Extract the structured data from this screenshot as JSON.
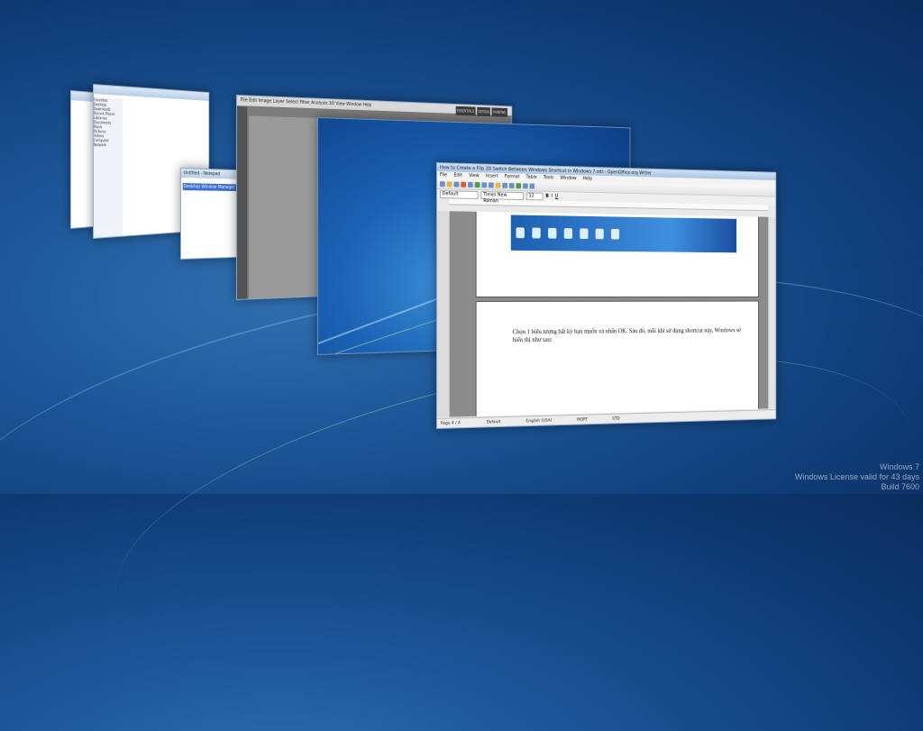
{
  "windows": {
    "explorer_small": {
      "title": ""
    },
    "explorer": {
      "title": "Favorites",
      "nav_items": [
        "Favorites",
        "Desktop",
        "Downloads",
        "Recent Places",
        "Libraries",
        "Documents",
        "Music",
        "Pictures",
        "Videos",
        "Computer",
        "Network"
      ]
    },
    "notepad": {
      "title": "Untitled - Notepad",
      "content": "Desktop Window Manager"
    },
    "photoshop": {
      "menus": [
        "File",
        "Edit",
        "Image",
        "Layer",
        "Select",
        "Filter",
        "Analysis",
        "3D",
        "View",
        "Window",
        "Help"
      ],
      "workspace_tabs": [
        "ESSENTIALS",
        "DESIGN",
        "PAINTING"
      ]
    },
    "writer": {
      "title": "How to Create a Flip 3D Switch Between Windows Shortcut in Windows 7.odt - OpenOffice.org Writer",
      "menus": [
        "File",
        "Edit",
        "View",
        "Insert",
        "Format",
        "Table",
        "Tools",
        "Window",
        "Help"
      ],
      "style": "Default",
      "font": "Times New Roman",
      "size": "12",
      "body_text": "Chọn 1 biểu tượng bất kỳ bạn muốn và nhấn OK. Sau đó, mỗi khi sử dụng shortcut này, Windows sẽ hiển thị như sau:",
      "status": {
        "page": "Page 4 / 4",
        "style": "Default",
        "language": "English (USA)",
        "mode": "INSRT",
        "sel": "STD"
      }
    }
  },
  "watermark": {
    "line1": "Windows 7",
    "line2": "Windows License valid for 43 days",
    "line3": "Build 7600"
  }
}
